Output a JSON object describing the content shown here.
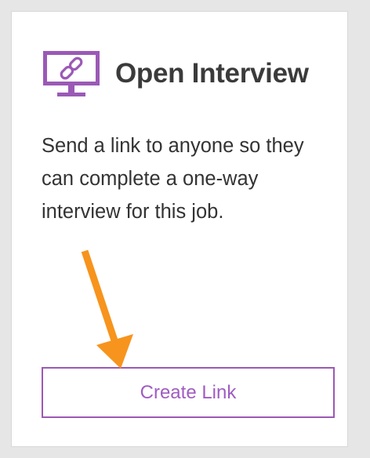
{
  "card": {
    "title": "Open Interview",
    "description": "Send a link to anyone so they can complete a one-way interview for this job.",
    "button_label": "Create Link",
    "icon": "monitor-link-icon",
    "accent_color": "#9b59b6"
  },
  "annotation": {
    "arrow_icon": "arrow-pointer-icon",
    "arrow_color": "#f7941d"
  }
}
